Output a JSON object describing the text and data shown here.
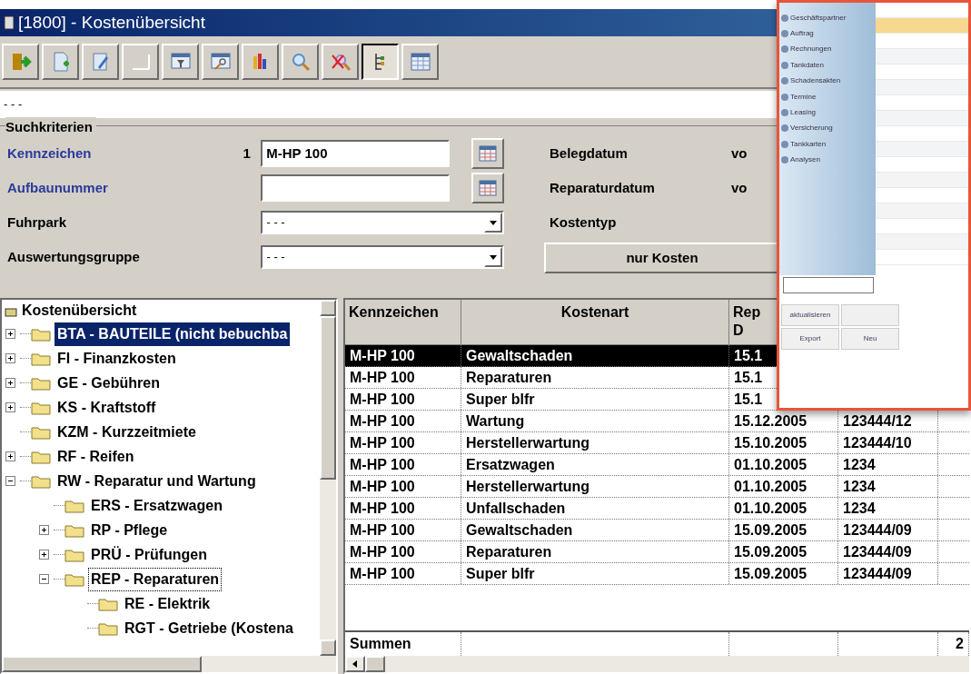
{
  "window": {
    "title": "[1800] - Kostenübersicht"
  },
  "toolbar": [
    {
      "pressed": false
    },
    {
      "pressed": false
    },
    {
      "pressed": false
    },
    {
      "pressed": false
    },
    {
      "pressed": false
    },
    {
      "pressed": false
    },
    {
      "pressed": false
    },
    {
      "pressed": false
    },
    {
      "pressed": false
    },
    {
      "pressed": true
    },
    {
      "pressed": false
    }
  ],
  "info_line": "- - -",
  "search": {
    "title": "Suchkriterien",
    "left": [
      {
        "kind": "text",
        "label": "Kennzeichen",
        "emphasized": true,
        "index": "1",
        "value": "M-HP 100"
      },
      {
        "kind": "text",
        "label": "Aufbaunummer",
        "emphasized": true
      },
      {
        "kind": "dropdown",
        "label": "Fuhrpark",
        "emphasized": false,
        "value": "- - -"
      },
      {
        "kind": "dropdown",
        "label": "Auswertungsgruppe",
        "emphasized": false,
        "value": "- - -"
      }
    ],
    "right": [
      {
        "label": "Belegdatum",
        "suffix": "vo"
      },
      {
        "label": "Reparaturdatum",
        "suffix": "vo"
      },
      {
        "label": "Kostentyp"
      }
    ],
    "button": "nur Kosten"
  },
  "tree": {
    "root": "Kostenübersicht",
    "items": [
      {
        "label": "BTA - BAUTEILE (nicht bebuchba",
        "expanded": false,
        "selected": true,
        "focused": false
      },
      {
        "label": "FI - Finanzkosten",
        "expanded": false,
        "selected": false,
        "focused": false
      },
      {
        "label": "GE - Gebühren",
        "expanded": false,
        "selected": false,
        "focused": false
      },
      {
        "label": "KS - Kraftstoff",
        "expanded": false,
        "selected": false,
        "focused": false
      },
      {
        "label": "KZM - Kurzzeitmiete",
        "selected": false,
        "focused": false
      },
      {
        "label": "RF - Reifen",
        "expanded": false,
        "selected": false,
        "focused": false
      },
      {
        "label": "RW - Reparatur und Wartung",
        "expanded": true,
        "selected": false,
        "focused": false,
        "children": [
          {
            "label": "ERS - Ersatzwagen",
            "selected": false,
            "focused": false
          },
          {
            "label": "RP - Pflege",
            "expanded": false,
            "selected": false,
            "focused": false
          },
          {
            "label": "PRÜ - Prüfungen",
            "expanded": false,
            "selected": false,
            "focused": false
          },
          {
            "label": "REP - Reparaturen",
            "expanded": true,
            "selected": false,
            "focused": true,
            "children": [
              {
                "label": "RE - Elektrik",
                "selected": false,
                "focused": false
              },
              {
                "label": "RGT - Getriebe (Kostena",
                "selected": false,
                "focused": false
              }
            ]
          }
        ]
      }
    ]
  },
  "table": {
    "columns": [
      {
        "label": "Kennzeichen"
      },
      {
        "label": "Kostenart"
      },
      {
        "label": "Rep\nD"
      }
    ],
    "rows": [
      {
        "selected": true,
        "cells": [
          "M-HP 100",
          "Gewaltschaden",
          "15.1"
        ]
      },
      {
        "selected": false,
        "cells": [
          "M-HP 100",
          "Reparaturen",
          "15.1"
        ]
      },
      {
        "selected": false,
        "cells": [
          "M-HP 100",
          "Super blfr",
          "15.1"
        ]
      },
      {
        "selected": false,
        "cells": [
          "M-HP 100",
          "Wartung",
          "15.12.2005",
          "123444/12"
        ]
      },
      {
        "selected": false,
        "cells": [
          "M-HP 100",
          "Herstellerwartung",
          "15.10.2005",
          "123444/10"
        ]
      },
      {
        "selected": false,
        "cells": [
          "M-HP 100",
          "Ersatzwagen",
          "01.10.2005",
          "1234"
        ]
      },
      {
        "selected": false,
        "cells": [
          "M-HP 100",
          "Herstellerwartung",
          "01.10.2005",
          "1234"
        ]
      },
      {
        "selected": false,
        "cells": [
          "M-HP 100",
          "Unfallschaden",
          "01.10.2005",
          "1234"
        ]
      },
      {
        "selected": false,
        "cells": [
          "M-HP 100",
          "Gewaltschaden",
          "15.09.2005",
          "123444/09"
        ]
      },
      {
        "selected": false,
        "cells": [
          "M-HP 100",
          "Reparaturen",
          "15.09.2005",
          "123444/09"
        ]
      },
      {
        "selected": false,
        "cells": [
          "M-HP 100",
          "Super blfr",
          "15.09.2005",
          "123444/09"
        ]
      }
    ],
    "totals": {
      "label": "Summen",
      "last": "2"
    }
  },
  "overlay": {
    "menu": [
      "Geschäftspartner",
      "Auftrag",
      "Rechnungen",
      "Tankdaten",
      "Schadensakten",
      "Termine",
      "Leasing",
      "Versicherung",
      "Tankkarten",
      "Analysen"
    ],
    "buttons": [
      {
        "kind": "labeled",
        "label": "aktualisieren"
      },
      {
        "kind": "blank"
      },
      {
        "kind": "labeled",
        "label": "Export"
      },
      {
        "kind": "labeled",
        "label": "Neu"
      }
    ]
  }
}
